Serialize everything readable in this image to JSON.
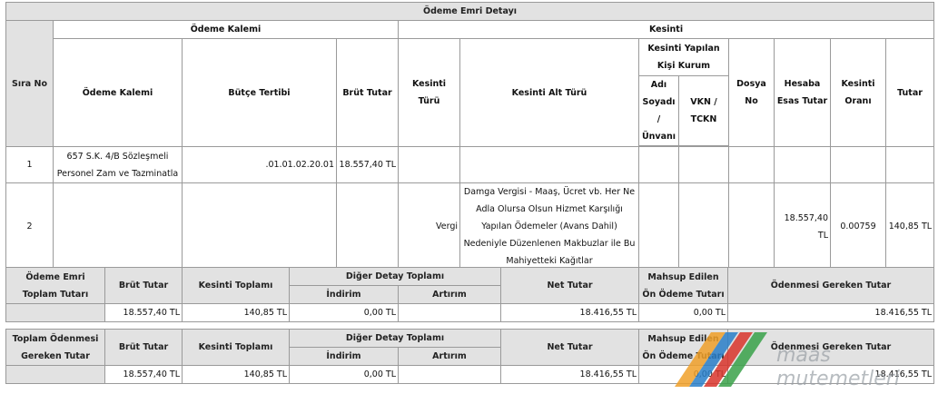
{
  "detail": {
    "title": "Ödeme Emri Detayı",
    "headers": {
      "sira_no": "Sıra No",
      "odeme_kalemi_group": "Ödeme Kalemi",
      "kesinti_group": "Kesinti",
      "odeme_kalemi": "Ödeme Kalemi",
      "butce_tertibi": "Bütçe Tertibi",
      "brut_tutar": "Brüt Tutar",
      "kesinti_turu": "Kesinti Türü",
      "kesinti_alt_turu": "Kesinti Alt Türü",
      "kisi_kurum": "Kesinti Yapılan Kişi Kurum",
      "adi_soyadi": "Adı Soyadı / Ünvanı",
      "vkn": "VKN / TCKN",
      "dosya_no": "Dosya No",
      "hesaba_esas": "Hesaba Esas Tutar",
      "kesinti_orani": "Kesinti Oranı",
      "tutar": "Tutar"
    },
    "rows": [
      {
        "sira": "1",
        "odeme_kalemi": "657 S.K. 4/B Sözleşmeli Personel Zam ve Tazminatla",
        "butce": ".01.01.02.20.01",
        "brut": "18.557,40 TL",
        "kesinti_turu": "",
        "alt_turu": "",
        "adi": "",
        "vkn": "",
        "dosya": "",
        "hesaba": "",
        "oran": "",
        "tutar": ""
      },
      {
        "sira": "2",
        "odeme_kalemi": "",
        "butce": "",
        "brut": "",
        "kesinti_turu": "Vergi",
        "alt_turu": "Damga Vergisi - Maaş, Ücret vb. Her Ne Adla Olursa Olsun Hizmet Karşılığı Yapılan Ödemeler (Avans Dahil) Nedeniyle Düzenlenen Makbuzlar ile Bu Mahiyetteki Kağıtlar",
        "adi": "",
        "vkn": "",
        "dosya": "",
        "hesaba": "18.557,40 TL",
        "oran": "0.00759",
        "tutar": "140,85 TL"
      }
    ]
  },
  "summary": {
    "row_label": "Ödeme Emri Toplam Tutarı",
    "brut_label": "Brüt Tutar",
    "kesinti_label": "Kesinti Toplamı",
    "diger_label": "Diğer Detay Toplamı",
    "indirim_label": "İndirim",
    "artirim_label": "Artırım",
    "net_label": "Net Tutar",
    "mahsup_label": "Mahsup Edilen Ön Ödeme Tutarı",
    "odenmesi_label": "Ödenmesi Gereken Tutar",
    "brut": "18.557,40 TL",
    "kesinti": "140,85 TL",
    "indirim": "0,00 TL",
    "artirim": "",
    "net": "18.416,55 TL",
    "mahsup": "0,00 TL",
    "odenmesi": "18.416,55 TL"
  },
  "total": {
    "row_label": "Toplam Ödenmesi Gereken Tutar",
    "brut_label": "Brüt Tutar",
    "kesinti_label": "Kesinti Toplamı",
    "diger_label": "Diğer Detay Toplamı",
    "indirim_label": "İndirim",
    "artirim_label": "Artırım",
    "net_label": "Net Tutar",
    "mahsup_label": "Mahsup Edilen Ön Ödeme Tutarı",
    "odenmesi_label": "Ödenmesi Gereken Tutar",
    "brut": "18.557,40 TL",
    "kesinti": "140,85 TL",
    "indirim": "0,00 TL",
    "artirim": "",
    "net": "18.416,55 TL",
    "mahsup": "0,00 TL",
    "odenmesi": "18.416,55 TL"
  },
  "watermark": {
    "line1": "maas",
    "line2": "mutemetleri"
  },
  "colors": {
    "header_bg": "#e2e2e2",
    "border": "#9a9a9a",
    "wm_orange": "#f0a02a",
    "wm_blue": "#2a7fc9",
    "wm_red": "#d9352b",
    "wm_green": "#3aa24a"
  }
}
